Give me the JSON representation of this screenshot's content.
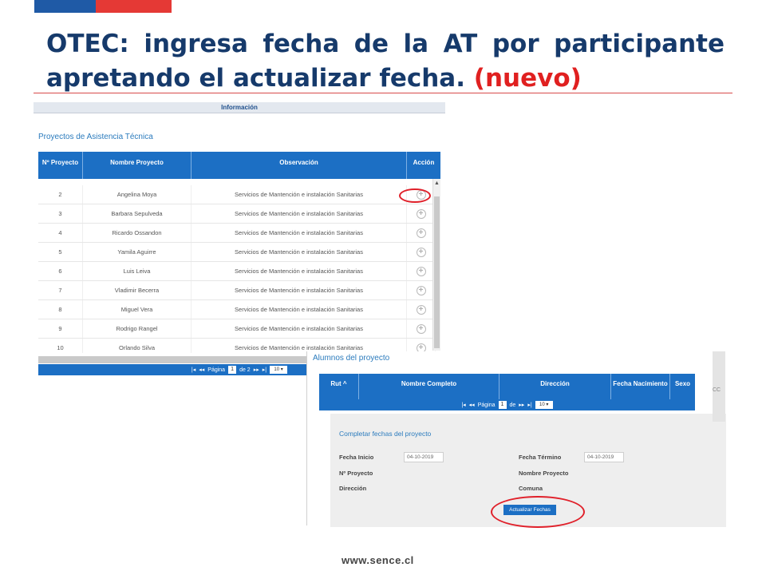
{
  "slide": {
    "title_main": "OTEC: ingresa fecha de la AT por participante apretando el actualizar fecha. ",
    "title_highlight": "(nuevo)",
    "footer_url": "www.sence.cl"
  },
  "left_panel": {
    "info_bar": "Información",
    "section_title": "Proyectos de Asistencia Técnica",
    "columns": [
      "Nº Proyecto",
      "Nombre Proyecto",
      "Observación",
      "Acción"
    ],
    "rows": [
      {
        "num": "2",
        "name": "Angelina Moya",
        "obs": "Servicios de Mantención e instalación Sanitarias"
      },
      {
        "num": "3",
        "name": "Barbara Sepulveda",
        "obs": "Servicios de Mantención e instalación Sanitarias"
      },
      {
        "num": "4",
        "name": "Ricardo Ossandon",
        "obs": "Servicios de Mantención e instalación Sanitarias"
      },
      {
        "num": "5",
        "name": "Yamila Aguirre",
        "obs": "Servicios de Mantención e instalación Sanitarias"
      },
      {
        "num": "6",
        "name": "Luis Leiva",
        "obs": "Servicios de Mantención e instalación Sanitarias"
      },
      {
        "num": "7",
        "name": "Vladimir Becerra",
        "obs": "Servicios de Mantención e instalación Sanitarias"
      },
      {
        "num": "8",
        "name": "Miguel Vera",
        "obs": "Servicios de Mantención e instalación Sanitarias"
      },
      {
        "num": "9",
        "name": "Rodrigo Rangel",
        "obs": "Servicios de Mantención e instalación Sanitarias"
      },
      {
        "num": "10",
        "name": "Orlando Silva",
        "obs": "Servicios de Mantención e instalación Sanitarias"
      }
    ],
    "pager": {
      "first": "|◂",
      "prev": "◂◂",
      "label": "Página",
      "page": "1",
      "of": "de 2",
      "next": "▸▸",
      "last": "▸|",
      "page_size": "10 ▾"
    }
  },
  "right_panel": {
    "title": "Alumnos del proyecto",
    "columns": [
      "Rut ^",
      "Nombre Completo",
      "Dirección",
      "Fecha Nacimiento",
      "Sexo"
    ],
    "gutter_text": "CC",
    "pager": {
      "first": "|◂",
      "prev": "◂◂",
      "label": "Página",
      "page": "1",
      "of": "de",
      "next": "▸▸",
      "last": "▸|",
      "page_size": "10 ▾"
    },
    "form": {
      "title": "Completar fechas del proyecto",
      "fecha_inicio_label": "Fecha Inicio",
      "fecha_inicio_value": "04-10-2019",
      "fecha_termino_label": "Fecha Término",
      "fecha_termino_value": "04-10-2019",
      "nro_proyecto_label": "Nº Proyecto",
      "nombre_proyecto_label": "Nombre Proyecto",
      "direccion_label": "Dirección",
      "comuna_label": "Comuna",
      "button_label": "Actualizar Fechas"
    }
  },
  "colors": {
    "brand_blue": "#1c6fc4",
    "title_navy": "#163a6b",
    "accent_red": "#e02020"
  }
}
